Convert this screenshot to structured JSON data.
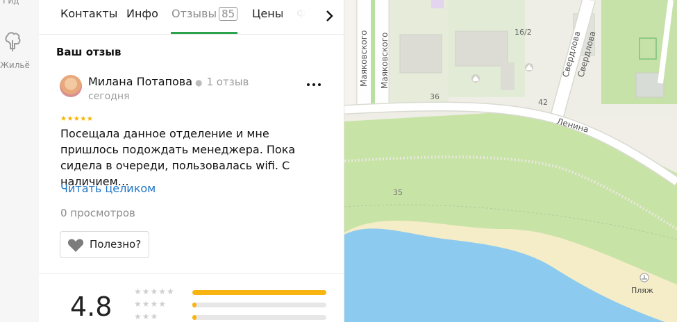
{
  "rail": {
    "top_label": "Гид",
    "item_label": "Жильё"
  },
  "tabs": [
    {
      "label": "Контакты"
    },
    {
      "label": "Инфо"
    },
    {
      "label": "Отзывы",
      "count": "85"
    },
    {
      "label": "Цены"
    },
    {
      "label": "Фо"
    }
  ],
  "review_section": {
    "title": "Ваш отзыв",
    "author": "Милана Потапова",
    "author_reviews": "1 отзыв",
    "date": "сегодня",
    "stars": "★★★★★",
    "text": "Посещала данное отделение и мне пришлось подождать менеджера. Пока сидела в очереди, пользовалась wifi. С наличием…",
    "read_more": "Читать целиком",
    "views": "0 просмотров",
    "useful_label": "Полезно?"
  },
  "rating": {
    "value": "4.8",
    "distribution": [
      {
        "stars": "★★★★★",
        "fraction": 1.0
      },
      {
        "stars": "★★★★",
        "fraction": 0.03
      },
      {
        "stars": "★★★",
        "fraction": 0.02
      }
    ]
  },
  "map": {
    "streets": {
      "mayakovskogo_1": "Маяковского",
      "mayakovskogo_2": "Маяковского",
      "sverdlova_1": "Свердлова",
      "sverdlova_2": "Свердлова",
      "lenina": "Ленина"
    },
    "house_numbers": {
      "h16_2": "16/2",
      "h36": "36",
      "h42": "42",
      "h35": "35"
    },
    "beach_label": "Пляж"
  },
  "colors": {
    "accent_green": "#2aa34a",
    "link_blue": "#1f76c8",
    "star_yellow": "#f5b500",
    "water": "#8ccbef",
    "park": "#c8e3a6",
    "sand": "#f5ecc8"
  }
}
